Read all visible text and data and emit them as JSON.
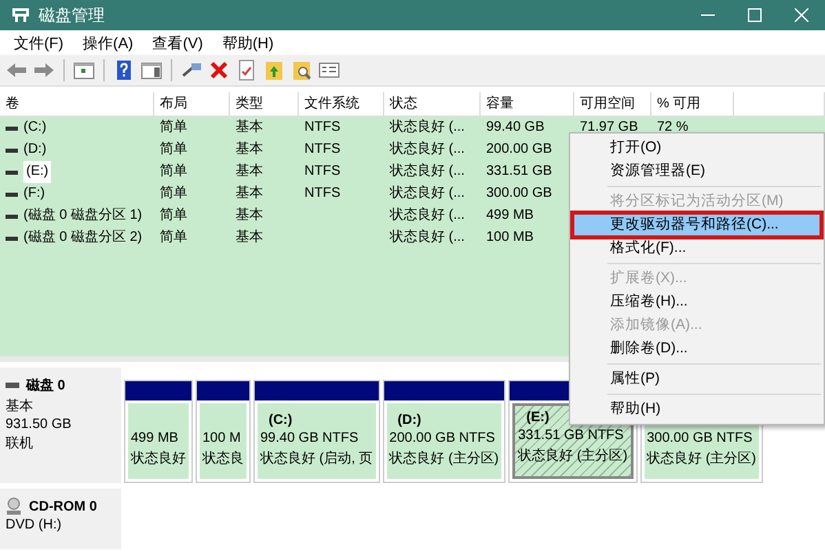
{
  "window": {
    "title": "磁盘管理"
  },
  "menu_bar": [
    "文件(F)",
    "操作(A)",
    "查看(V)",
    "帮助(H)"
  ],
  "table": {
    "columns": [
      "卷",
      "布局",
      "类型",
      "文件系统",
      "状态",
      "容量",
      "可用空间",
      "% 可用"
    ],
    "rows": [
      {
        "cells": [
          "(C:)",
          "简单",
          "基本",
          "NTFS",
          "状态良好 (...",
          "99.40 GB",
          "71.97 GB",
          "72 %"
        ],
        "selected": false
      },
      {
        "cells": [
          "(D:)",
          "简单",
          "基本",
          "NTFS",
          "状态良好 (...",
          "200.00 GB"
        ],
        "selected": false
      },
      {
        "cells": [
          "(E:)",
          "简单",
          "基本",
          "NTFS",
          "状态良好 (...",
          "331.51 GB"
        ],
        "selected": true
      },
      {
        "cells": [
          "(F:)",
          "简单",
          "基本",
          "NTFS",
          "状态良好 (...",
          "300.00 GB"
        ],
        "selected": false
      },
      {
        "cells": [
          "(磁盘 0 磁盘分区 1)",
          "简单",
          "基本",
          "",
          "状态良好 (...",
          "499 MB"
        ],
        "selected": false
      },
      {
        "cells": [
          "(磁盘 0 磁盘分区 2)",
          "简单",
          "基本",
          "",
          "状态良好 (...",
          "100 MB"
        ],
        "selected": false
      }
    ]
  },
  "disks": [
    {
      "kind": "disk",
      "name": "磁盘 0",
      "info": [
        "基本",
        "931.50 GB",
        "联机"
      ],
      "partitions": [
        {
          "lines": [
            "499 MB",
            "状态良好"
          ],
          "selected": false
        },
        {
          "lines": [
            "100 M",
            "状态良"
          ],
          "selected": false
        },
        {
          "title": "(C:)",
          "lines": [
            "99.40 GB NTFS",
            "状态良好 (启动, 页"
          ],
          "selected": false
        },
        {
          "title": "(D:)",
          "lines": [
            "200.00 GB NTFS",
            "状态良好 (主分区)"
          ],
          "selected": false
        },
        {
          "title": "(E:)",
          "lines": [
            "331.51 GB NTFS",
            "状态良好 (主分区)"
          ],
          "selected": true
        },
        {
          "lines": [
            "300.00 GB NTFS",
            "状态良好 (主分区)"
          ],
          "selected": false
        }
      ]
    },
    {
      "kind": "cdrom",
      "name": "CD-ROM 0",
      "info": [
        "DVD (H:)"
      ]
    }
  ],
  "context_menu": [
    {
      "kind": "item",
      "label": "打开(O)",
      "disabled": false,
      "selected": false
    },
    {
      "kind": "item",
      "label": "资源管理器(E)",
      "disabled": false,
      "selected": false
    },
    {
      "kind": "separator"
    },
    {
      "kind": "item",
      "label": "将分区标记为活动分区(M)",
      "disabled": true,
      "selected": false
    },
    {
      "kind": "item",
      "label": "更改驱动器号和路径(C)...",
      "disabled": false,
      "selected": true
    },
    {
      "kind": "item",
      "label": "格式化(F)...",
      "disabled": false,
      "selected": false
    },
    {
      "kind": "separator"
    },
    {
      "kind": "item",
      "label": "扩展卷(X)...",
      "disabled": true,
      "selected": false
    },
    {
      "kind": "item",
      "label": "压缩卷(H)...",
      "disabled": false,
      "selected": false
    },
    {
      "kind": "item",
      "label": "添加镜像(A)...",
      "disabled": true,
      "selected": false
    },
    {
      "kind": "item",
      "label": "删除卷(D)...",
      "disabled": false,
      "selected": false
    },
    {
      "kind": "separator"
    },
    {
      "kind": "item",
      "label": "属性(P)",
      "disabled": false,
      "selected": false
    },
    {
      "kind": "separator"
    },
    {
      "kind": "item",
      "label": "帮助(H)",
      "disabled": false,
      "selected": false
    }
  ]
}
